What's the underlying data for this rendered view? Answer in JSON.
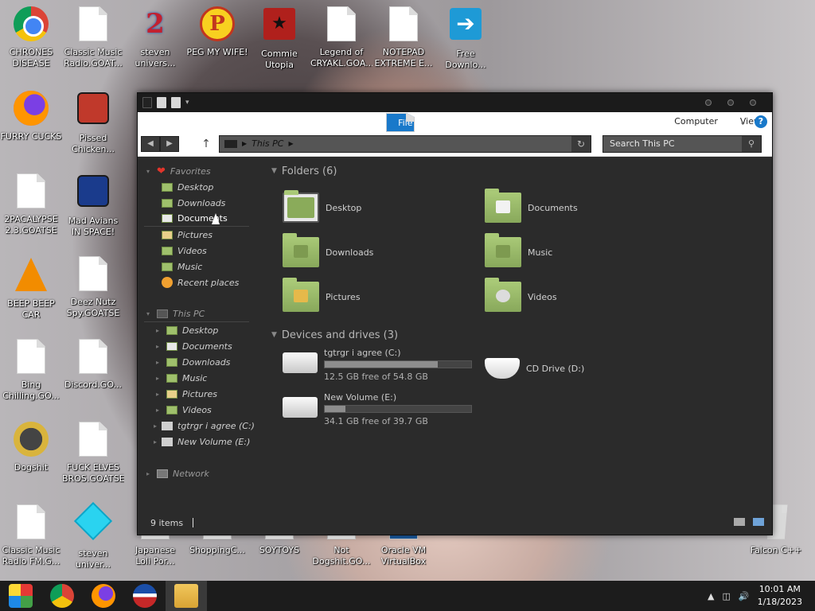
{
  "desktop": {
    "icons": [
      {
        "label": "CHRONES\nDISEASE",
        "icon": "chrome-icon"
      },
      {
        "label": "Classic Music\nRadio.GOAT...",
        "icon": "file-icon"
      },
      {
        "label": "steven\nunivers...",
        "icon": "app-icon"
      },
      {
        "label": "PEG MY WIFE!",
        "icon": "peg-icon"
      },
      {
        "label": "Commie\nUtopia",
        "icon": "game-icon"
      },
      {
        "label": "Legend of\nCRYAKL.GOA...",
        "icon": "file-icon"
      },
      {
        "label": "NOTEPAD\nEXTREME E...",
        "icon": "file-icon"
      },
      {
        "label": "Free\nDownlo...",
        "icon": "download-icon"
      },
      {
        "label": "FURRY CUCKS",
        "icon": "firefox-icon"
      },
      {
        "label": "Pissed\nChicken...",
        "icon": "angry-birds-icon"
      },
      {
        "label": "2PACALYPSE\n2.3.GOATSE",
        "icon": "file-icon"
      },
      {
        "label": "Mad Avians\nIN SPACE!",
        "icon": "angry-birds-space-icon"
      },
      {
        "label": "BEEP BEEP\nCAR",
        "icon": "vlc-icon"
      },
      {
        "label": "Deez Nutz\nSpy.GOATSE",
        "icon": "file-icon"
      },
      {
        "label": "Bing\nChilling.GO...",
        "icon": "file-icon"
      },
      {
        "label": "Discord.GO...",
        "icon": "file-icon"
      },
      {
        "label": "Dogshit",
        "icon": "dogshit-icon"
      },
      {
        "label": "FUCK ELVES\nBROS.GOATSE",
        "icon": "file-icon"
      },
      {
        "label": "Classic Music\nRadio FM.G...",
        "icon": "file-icon"
      },
      {
        "label": "steven\nuniver...",
        "icon": "gem-icon"
      },
      {
        "label": "Japanese\nLoli Por...",
        "icon": "file-icon"
      },
      {
        "label": "ShoppingC...",
        "icon": "file-icon"
      },
      {
        "label": "SOYTOYS",
        "icon": "file-icon"
      },
      {
        "label": "Not\nDogshit.GO...",
        "icon": "file-icon"
      },
      {
        "label": "Oracle VM\nVirtualBox",
        "icon": "virtualbox-icon"
      },
      {
        "label": "Falcon C++",
        "icon": "recycle-bin-icon"
      }
    ]
  },
  "window": {
    "ribbon": {
      "tabs": [
        "File",
        "Computer",
        "View"
      ]
    },
    "address": {
      "location": "This PC"
    },
    "search": {
      "placeholder": "Search This PC"
    },
    "nav": {
      "favorites_label": "Favorites",
      "favorites": [
        "Desktop",
        "Downloads",
        "Documents",
        "Pictures",
        "Videos",
        "Music",
        "Recent places"
      ],
      "this_pc_label": "This PC",
      "this_pc": [
        "Desktop",
        "Documents",
        "Downloads",
        "Music",
        "Pictures",
        "Videos",
        "tgtrgr i agree (C:)",
        "New Volume (E:)"
      ],
      "network_label": "Network"
    },
    "folders_header": "Folders (6)",
    "folders": [
      "Desktop",
      "Documents",
      "Downloads",
      "Music",
      "Pictures",
      "Videos"
    ],
    "drives_header": "Devices and drives (3)",
    "drives": [
      {
        "name": "tgtrgr i agree (C:)",
        "free": "12.5 GB free of 54.8 GB",
        "used_fraction": 0.77
      },
      {
        "name": "New Volume (E:)",
        "free": "34.1 GB free of 39.7 GB",
        "used_fraction": 0.14
      }
    ],
    "cd_drive": "CD Drive (D:)",
    "status": "9 items"
  },
  "taskbar": {
    "time": "10:01 AM",
    "date": "1/18/2023"
  }
}
